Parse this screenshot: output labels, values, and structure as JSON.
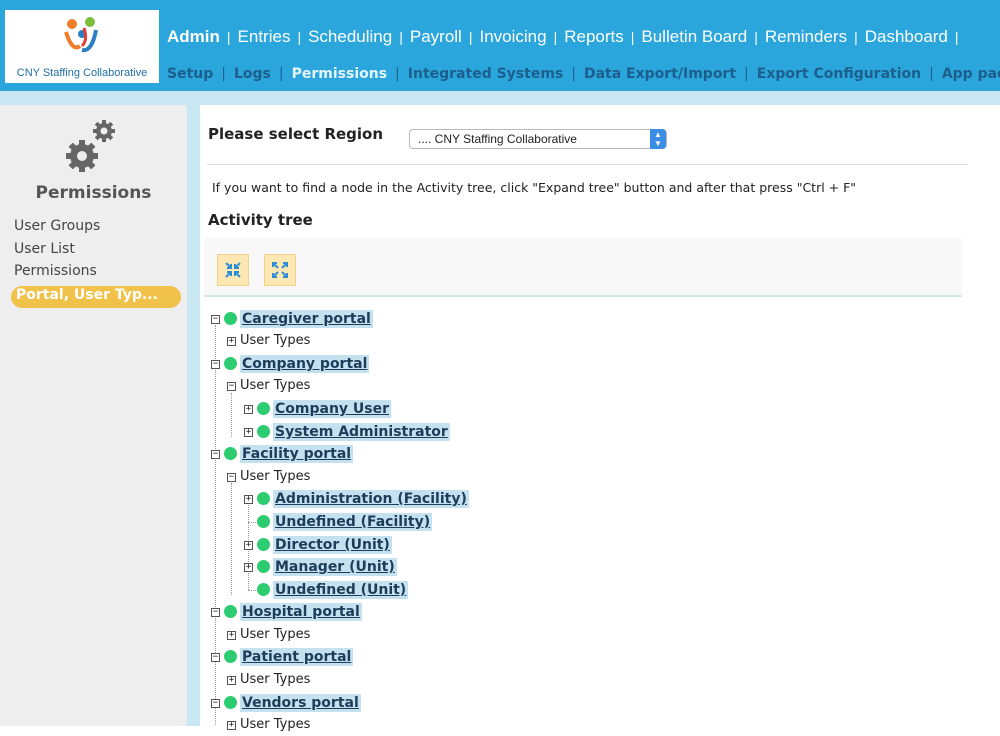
{
  "header": {
    "logo_text": "CNY Staffing Collaborative",
    "top_nav": [
      {
        "label": "Admin",
        "bold": true
      },
      {
        "label": "Entries"
      },
      {
        "label": "Scheduling"
      },
      {
        "label": "Payroll"
      },
      {
        "label": "Invoicing"
      },
      {
        "label": "Reports"
      },
      {
        "label": "Bulletin Board"
      },
      {
        "label": "Reminders"
      },
      {
        "label": "Dashboard"
      },
      {
        "label": "|"
      }
    ],
    "sub_nav": [
      {
        "label": "Setup"
      },
      {
        "label": "Logs"
      },
      {
        "label": "Permissions",
        "active": true
      },
      {
        "label": "Integrated Systems"
      },
      {
        "label": "Data Export/Import"
      },
      {
        "label": "Export Configuration"
      },
      {
        "label": "App pack"
      }
    ],
    "separator": "|"
  },
  "sidebar": {
    "title": "Permissions",
    "links": [
      "User Groups",
      "User List",
      "Permissions"
    ],
    "active": "Portal, User Typ..."
  },
  "main": {
    "region_label": "Please select Region",
    "region_value": ".... CNY Staffing Collaborative",
    "hint": "If you want to find a node in the Activity tree, click \"Expand tree\" button and after that press \"Ctrl + F\"",
    "activity_title": "Activity tree",
    "collapse_icon": "collapse-arrows-icon",
    "expand_icon": "expand-arrows-icon",
    "tree": {
      "user_types_label": "User Types",
      "caregiver": "Caregiver portal",
      "company": "Company portal",
      "company_user": "Company User",
      "system_admin": "System Administrator",
      "facility": "Facility portal",
      "admin_facility": "Administration (Facility)",
      "undefined_facility": "Undefined (Facility)",
      "director_unit": "Director (Unit)",
      "manager_unit": "Manager (Unit)",
      "undefined_unit": "Undefined (Unit)",
      "hospital": "Hospital portal",
      "patient": "Patient portal",
      "vendors": "Vendors portal"
    }
  },
  "colors": {
    "header_blue": "#2aa6dd",
    "active_orange": "#f0c24a",
    "status_green": "#2ecc71"
  }
}
